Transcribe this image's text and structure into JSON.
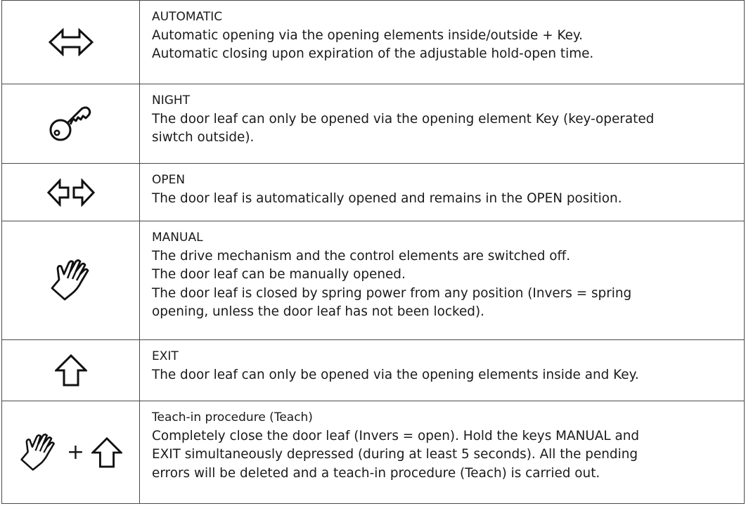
{
  "rows": [
    {
      "icon": "double-arrow-icon",
      "title": "AUTOMATIC",
      "lines": [
        "Automatic opening via the opening elements inside/outside + Key.",
        "Automatic closing upon expiration of the adjustable hold-open time."
      ]
    },
    {
      "icon": "key-icon",
      "title": "NIGHT",
      "lines": [
        "The door leaf can only be opened via the opening element Key (key-operated",
        "siwtch outside)."
      ]
    },
    {
      "icon": "split-arrows-icon",
      "title": "OPEN",
      "lines": [
        "The door leaf is automatically opened and remains in the OPEN position."
      ]
    },
    {
      "icon": "hand-icon",
      "title": "MANUAL",
      "lines": [
        "The drive mechanism and the control elements are switched off.",
        "The door leaf can be manually opened.",
        "The door leaf is closed by spring power from any position (Invers = spring",
        "opening, unless the door leaf has not been locked)."
      ]
    },
    {
      "icon": "up-arrow-icon",
      "title": "EXIT",
      "lines": [
        "The door leaf can only be opened via the opening elements inside and Key."
      ]
    },
    {
      "icon": "hand-plus-up-arrow-icon",
      "plus": "+",
      "title": "Teach-in procedure (Teach)",
      "lines": [
        "Completely close the door leaf (Invers = open). Hold the keys MANUAL and",
        "EXIT simultaneously depressed (during at least 5 seconds). All the pending",
        "errors will be deleted and a teach-in procedure (Teach) is carried out."
      ]
    }
  ]
}
